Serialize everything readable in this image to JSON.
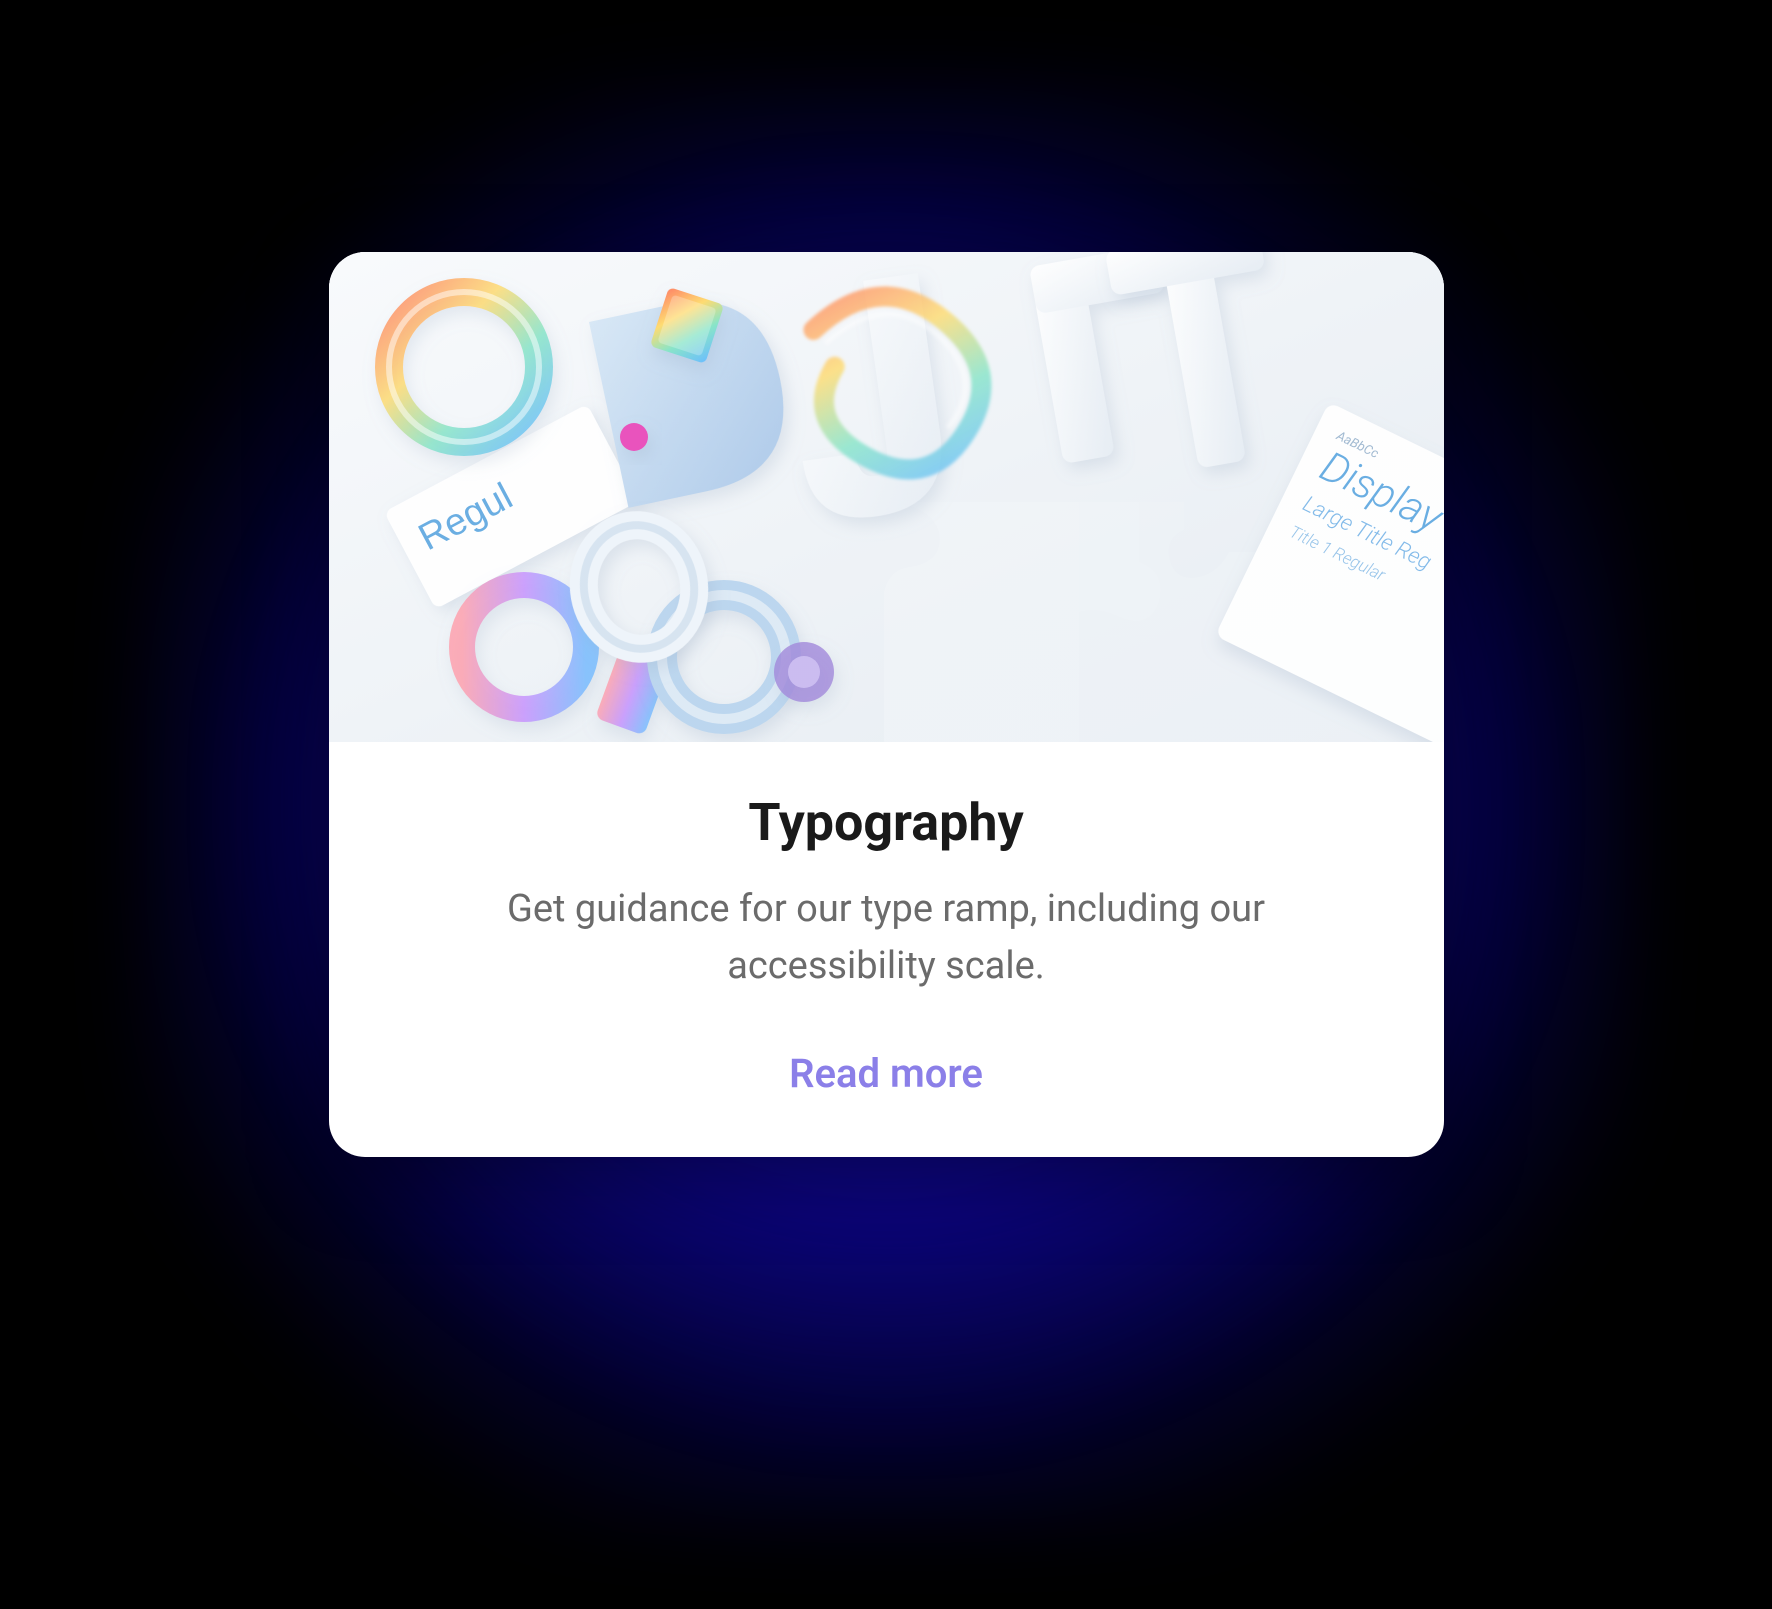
{
  "card": {
    "title": "Typography",
    "description": "Get guidance for our type ramp, including our accessibility scale.",
    "link_label": "Read more",
    "image_alt": "3D rendered typography letters and shapes",
    "image_text": {
      "left_label": "Regul",
      "right_heading": "Display",
      "right_sub1": "Large Title Reg",
      "right_sub2": "Title 1 Regular",
      "right_small": "AaBbCc"
    }
  },
  "colors": {
    "link": "#8B7FE8",
    "title": "#1a1a1a",
    "description": "#6b6b6b",
    "card_bg": "#ffffff",
    "glow": "#1a0fc8"
  }
}
